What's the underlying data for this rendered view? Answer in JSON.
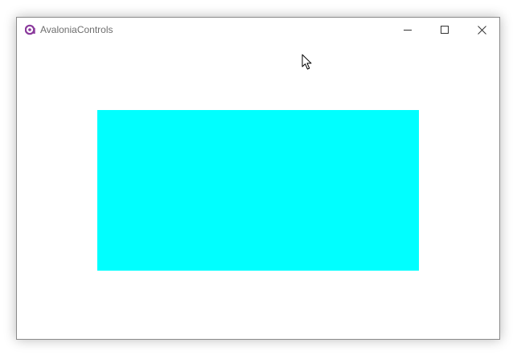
{
  "window": {
    "title": "AvaloniaControls",
    "app_icon": "avalonia-logo-icon",
    "caption_buttons": [
      "minimize-icon",
      "maximize-icon",
      "close-icon"
    ]
  },
  "content": {
    "rectangle_fill": "#00FFFF"
  },
  "cursor": "arrow-pointer-icon"
}
